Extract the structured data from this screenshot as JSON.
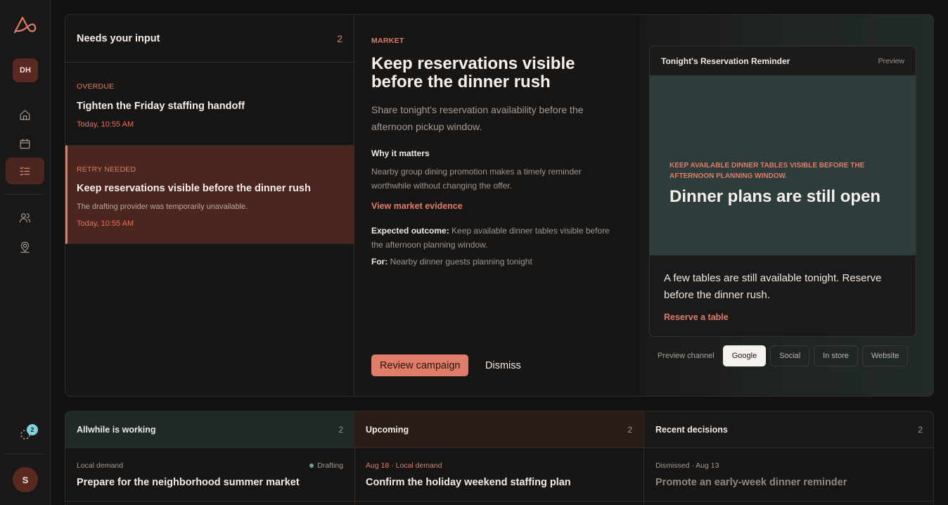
{
  "sidebar": {
    "workspace_initials": "DH",
    "user_initial": "S",
    "activity_count": "2",
    "nav": [
      "home-icon",
      "calendar-icon",
      "tasks-icon",
      "people-icon",
      "location-person-icon"
    ]
  },
  "inbox": {
    "title": "Needs your input",
    "count": "2",
    "items": [
      {
        "tag": "OVERDUE",
        "title": "Tighten the Friday staffing handoff",
        "note": "",
        "time": "Today, 10:55 AM"
      },
      {
        "tag": "RETRY NEEDED",
        "title": "Keep reservations visible before the dinner rush",
        "note": "The drafting provider was temporarily unavailable.",
        "time": "Today, 10:55 AM"
      }
    ]
  },
  "detail": {
    "kicker": "MARKET",
    "headline": "Keep reservations visible before the dinner rush",
    "subhead": "Share tonight's reservation availability before the afternoon pickup window.",
    "why_heading": "Why it matters",
    "why_text": "Nearby group dining promotion makes a timely reminder worthwhile without changing the offer.",
    "evidence_link": "View market evidence",
    "outcome_label": "Expected outcome:",
    "outcome_text": "Keep available dinner tables visible before the afternoon planning window.",
    "for_label": "For:",
    "for_text": "Nearby dinner guests planning tonight",
    "primary_button": "Review campaign",
    "secondary_button": "Dismiss"
  },
  "preview": {
    "title": "Tonight's Reservation Reminder",
    "tag": "Preview",
    "eyebrow": "KEEP AVAILABLE DINNER TABLES VISIBLE BEFORE THE AFTERNOON PLANNING WINDOW.",
    "headline": "Dinner plans are still open",
    "body": "A few tables are still available tonight. Reserve before the dinner rush.",
    "cta": "Reserve a table",
    "channel_label": "Preview channel",
    "channels": [
      "Google",
      "Social",
      "In store",
      "Website"
    ],
    "selected_channel": "Google"
  },
  "board": {
    "columns": [
      {
        "title": "Allwhile is working",
        "count": "2",
        "item": {
          "meta": "Local demand",
          "status": "Drafting",
          "title": "Prepare for the neighborhood summer market"
        }
      },
      {
        "title": "Upcoming",
        "count": "2",
        "item": {
          "meta": "Aug 18 · Local demand",
          "status": "",
          "title": "Confirm the holiday weekend staffing plan"
        }
      },
      {
        "title": "Recent decisions",
        "count": "2",
        "item": {
          "meta": "Dismissed · Aug 13",
          "status": "",
          "title": "Promote an early-week dinner reminder"
        }
      }
    ]
  },
  "colors": {
    "accent": "#e07d69",
    "background": "#121110",
    "teal_hero": "#2e3c3b"
  }
}
